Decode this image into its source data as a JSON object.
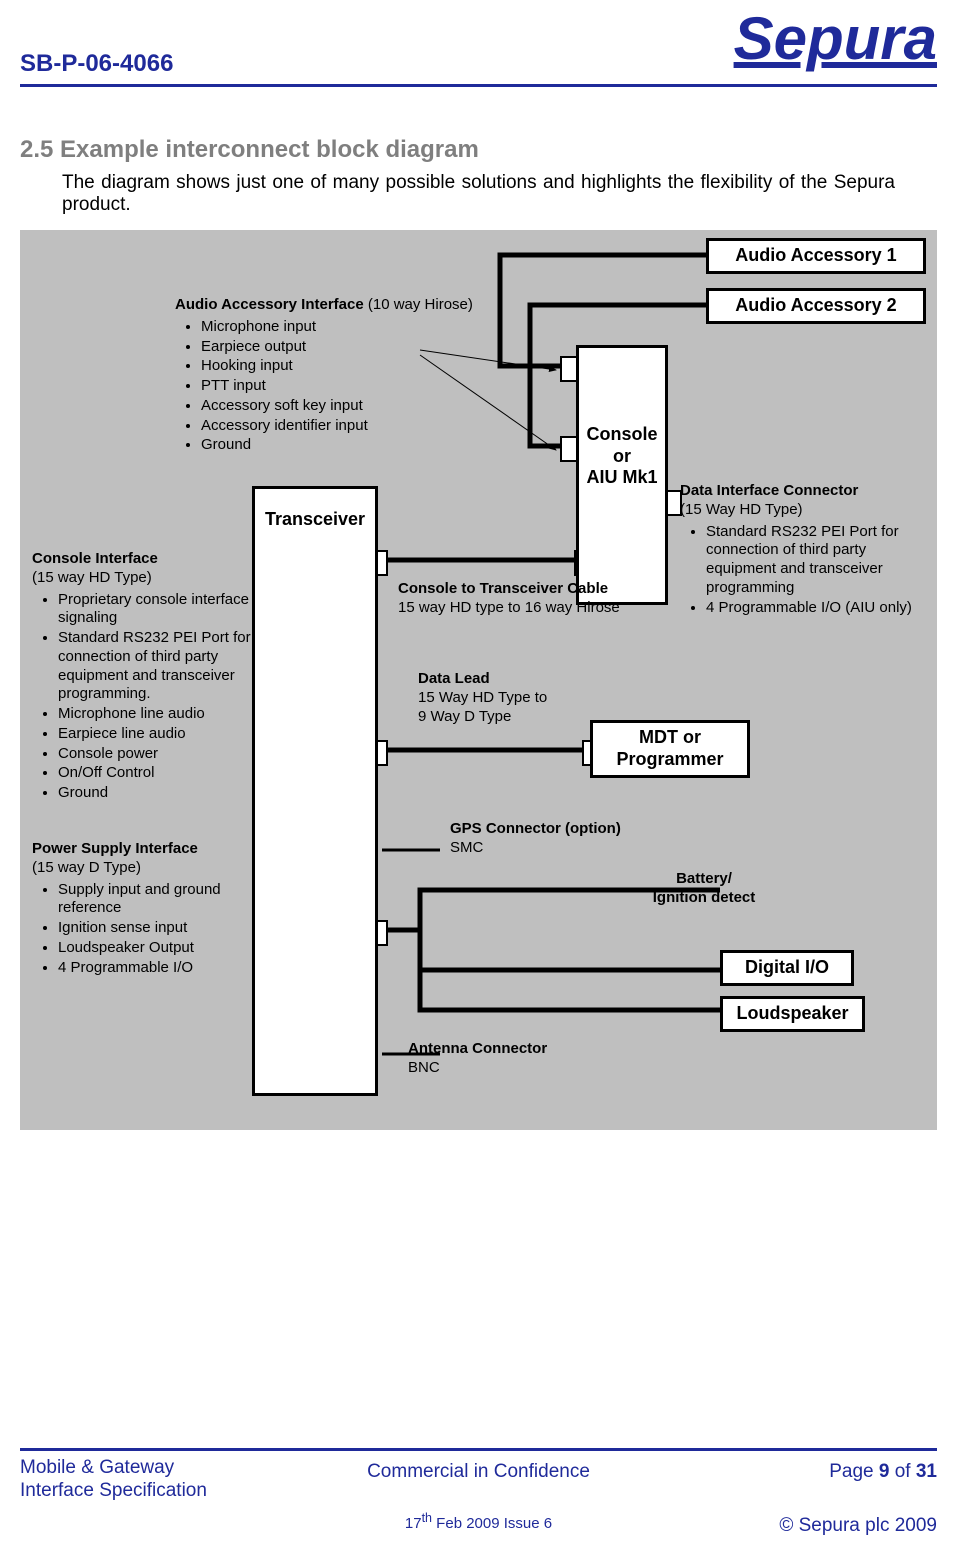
{
  "header": {
    "docnum": "SB-P-06-4066",
    "brand": "Sepura"
  },
  "section_title": "2.5 Example interconnect block diagram",
  "intro": "The diagram shows just one of many possible solutions and highlights the flexibility of the Sepura product.",
  "blocks": {
    "audio1": "Audio Accessory 1",
    "audio2": "Audio Accessory 2",
    "console": "Console\nor\nAIU Mk1",
    "transceiver": "Transceiver",
    "mdt": "MDT or\nProgrammer",
    "digital_io": "Digital I/O",
    "loudspeaker": "Loudspeaker"
  },
  "audio_if": {
    "title": "Audio Accessory Interface (10 way Hirose)",
    "title_plain": "Audio Accessory Interface",
    "title_suffix": " (10 way Hirose)",
    "items": [
      "Microphone input",
      "Earpiece output",
      "Hooking input",
      "PTT input",
      "Accessory soft key input",
      "Accessory identifier input",
      "Ground"
    ]
  },
  "data_if": {
    "title": "Data Interface Connector",
    "subtitle": "(15 Way HD Type)",
    "items": [
      "Standard RS232 PEI Port for connection of third party equipment and transceiver programming",
      "4 Programmable I/O (AIU only)"
    ]
  },
  "console_if": {
    "title": "Console Interface",
    "subtitle": "(15 way HD Type)",
    "items": [
      "Proprietary console interface signaling",
      "Standard RS232 PEI Port for connection of third party equipment and transceiver programming.",
      "Microphone line audio",
      "Earpiece line audio",
      "Console power",
      "On/Off Control",
      "Ground"
    ]
  },
  "power_if": {
    "title": "Power Supply Interface",
    "subtitle": "(15 way D Type)",
    "items": [
      "Supply input and ground reference",
      "Ignition sense input",
      "Loudspeaker Output",
      "4 Programmable I/O"
    ]
  },
  "cable_console": {
    "title": "Console to Transceiver Cable",
    "sub": "15 way HD type to 16 way Hirose"
  },
  "data_lead": {
    "title": "Data Lead",
    "sub": "15 Way HD Type to\n9 Way D Type"
  },
  "gps": {
    "title": "GPS Connector  (option)",
    "sub": "SMC"
  },
  "battery": "Battery/\nIgnition detect",
  "antenna": {
    "title": "Antenna Connector",
    "sub": "BNC"
  },
  "footer": {
    "doc_title": "Mobile & Gateway\nInterface Specification",
    "cic": "Commercial in Confidence",
    "page_prefix": "Page ",
    "page_num": "9",
    "page_of": " of ",
    "page_total": "31",
    "issue_prefix": "17",
    "issue_sup": "th",
    "issue_suffix": " Feb 2009 Issue 6",
    "copyright": "© Sepura plc 2009"
  }
}
